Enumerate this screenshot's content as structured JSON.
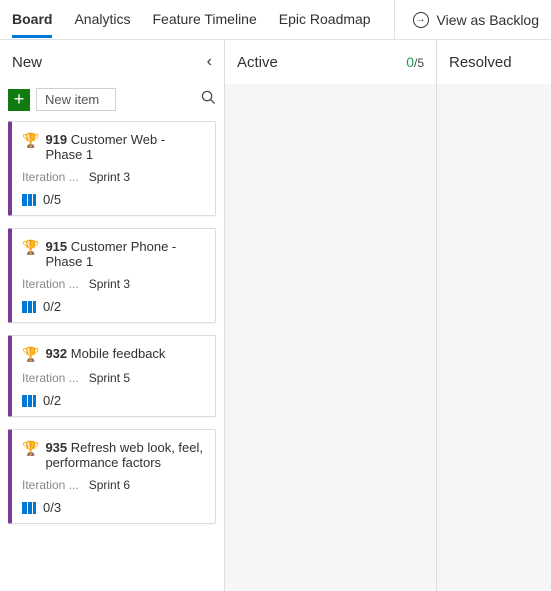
{
  "tabs": [
    {
      "label": "Board",
      "active": true
    },
    {
      "label": "Analytics",
      "active": false
    },
    {
      "label": "Feature Timeline",
      "active": false
    },
    {
      "label": "Epic Roadmap",
      "active": false
    }
  ],
  "viewToggle": {
    "label": "View as Backlog"
  },
  "columns": {
    "new": {
      "name": "New",
      "collapse_glyph": "‹"
    },
    "active": {
      "name": "Active",
      "wip_num": "0",
      "wip_den": "/5"
    },
    "resolved": {
      "name": "Resolved"
    }
  },
  "newItem": {
    "placeholder": "New item",
    "plus": "+"
  },
  "cards": [
    {
      "id": "919",
      "title": "Customer Web - Phase 1",
      "field_label": "Iteration ...",
      "field_value": "Sprint 3",
      "children": "0/5"
    },
    {
      "id": "915",
      "title": "Customer Phone - Phase 1",
      "field_label": "Iteration ...",
      "field_value": "Sprint 3",
      "children": "0/2"
    },
    {
      "id": "932",
      "title": "Mobile feedback",
      "field_label": "Iteration ...",
      "field_value": "Sprint 5",
      "children": "0/2"
    },
    {
      "id": "935",
      "title": "Refresh web look, feel, performance factors",
      "field_label": "Iteration ...",
      "field_value": "Sprint 6",
      "children": "0/3"
    }
  ]
}
